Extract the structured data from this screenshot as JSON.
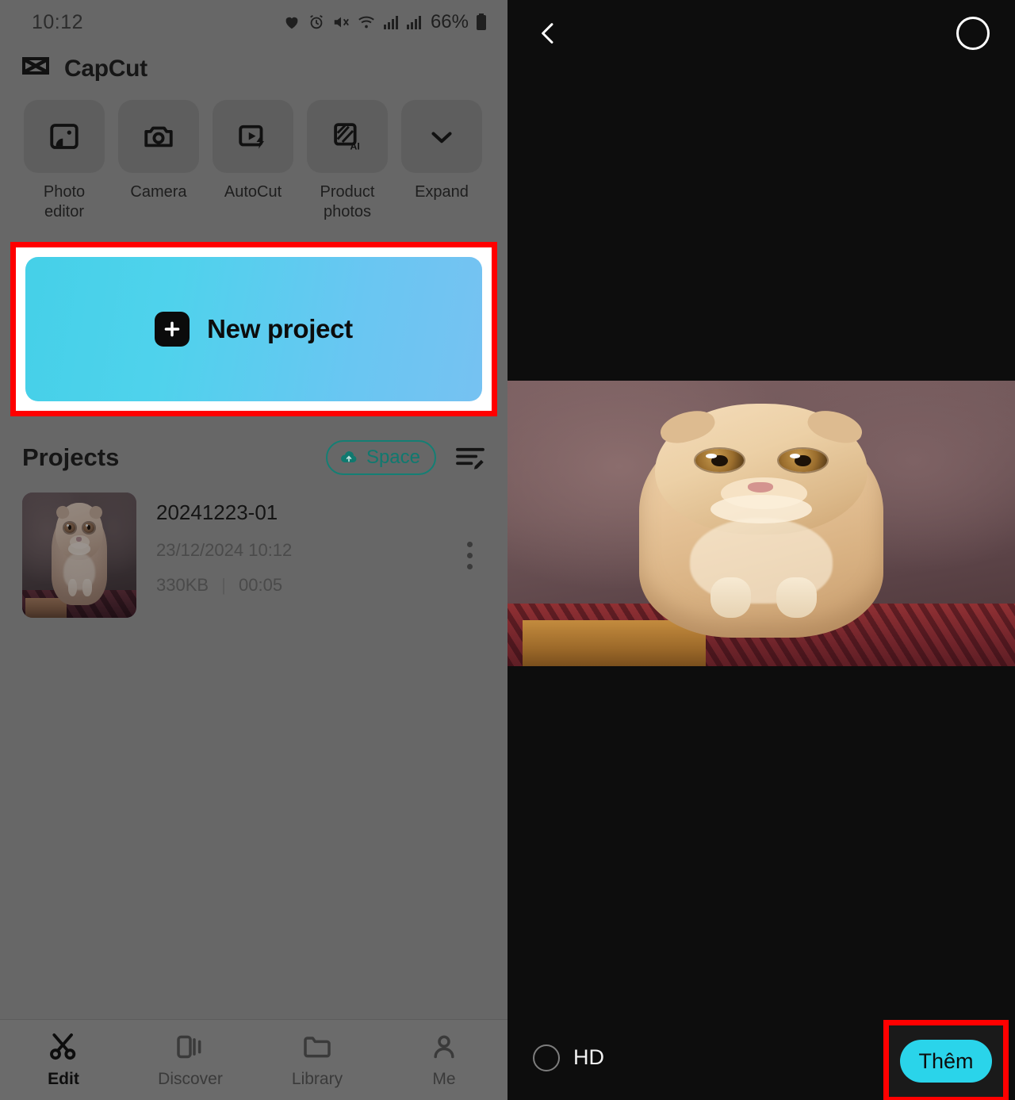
{
  "left": {
    "status_bar": {
      "time": "10:12",
      "battery_percent": "66%",
      "icons": [
        "heart-icon",
        "alarm-icon",
        "mute-icon",
        "wifi-icon",
        "signal-icon",
        "signal-icon",
        "battery-icon"
      ]
    },
    "brand": {
      "name": "CapCut",
      "logo": "capcut-logo-icon"
    },
    "tools": [
      {
        "label": "Photo editor",
        "icon": "photo-editor-icon"
      },
      {
        "label": "Camera",
        "icon": "camera-icon"
      },
      {
        "label": "AutoCut",
        "icon": "autocut-icon"
      },
      {
        "label": "Product photos",
        "icon": "product-photos-ai-icon"
      },
      {
        "label": "Expand",
        "icon": "chevron-down-icon"
      }
    ],
    "new_project": {
      "label": "New project",
      "icon": "plus-icon"
    },
    "projects": {
      "title": "Projects",
      "space_button": {
        "label": "Space",
        "icon": "cloud-upload-icon"
      },
      "manage_icon": "edit-list-icon",
      "items": [
        {
          "name": "20241223-01",
          "date": "23/12/2024 10:12",
          "size": "330KB",
          "separator": "|",
          "duration": "00:05",
          "menu_icon": "more-vertical-icon"
        }
      ]
    },
    "bottom_nav": [
      {
        "label": "Edit",
        "icon": "scissors-icon",
        "active": true
      },
      {
        "label": "Discover",
        "icon": "discover-icon",
        "active": false
      },
      {
        "label": "Library",
        "icon": "folder-icon",
        "active": false
      },
      {
        "label": "Me",
        "icon": "person-icon",
        "active": false
      }
    ]
  },
  "right": {
    "header": {
      "back_icon": "chevron-left-icon",
      "select_circle_icon": "select-circle-icon"
    },
    "preview": {
      "alt": "cat-photo-preview"
    },
    "bottom": {
      "hd_label": "HD",
      "hd_checked": false,
      "add_button_label": "Thêm"
    }
  },
  "colors": {
    "highlight_red": "#ff0000",
    "new_project_gradient_start": "#45d0e8",
    "new_project_gradient_end": "#76c2f2",
    "accent_cyan": "#2ad4ea",
    "space_teal": "#10796f",
    "left_panel_dim": "#676767",
    "right_panel_bg": "#0d0d0d"
  }
}
